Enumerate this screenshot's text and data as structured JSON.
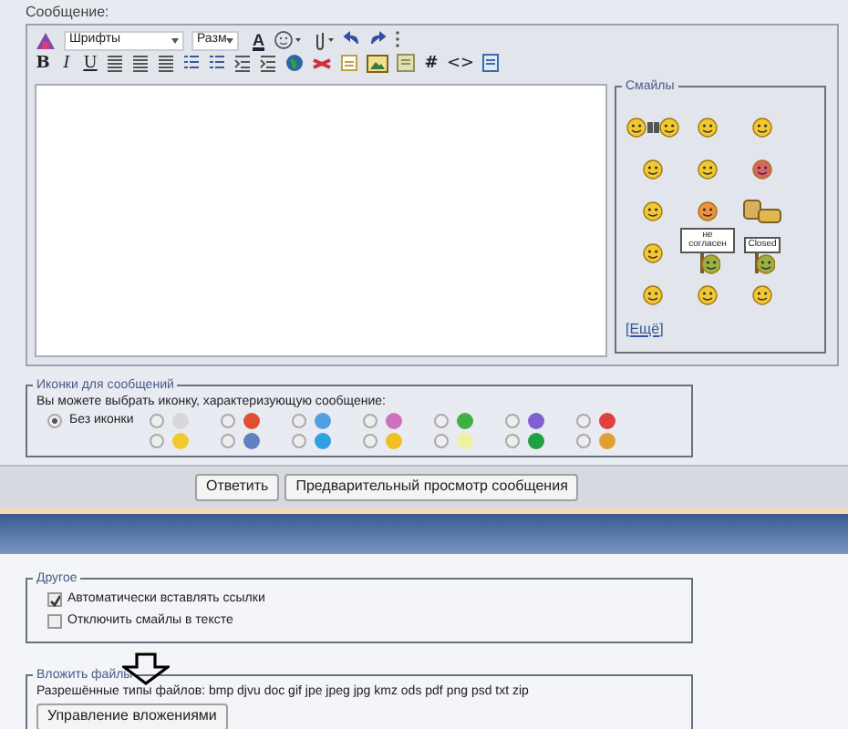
{
  "message_label": "Сообщение:",
  "toolbar": [
    [
      {
        "kind": "logo"
      },
      {
        "kind": "select",
        "value": "Шрифты"
      },
      {
        "kind": "select",
        "value": "Разм"
      },
      {
        "kind": "color",
        "text": "A"
      },
      {
        "kind": "smiley-menu"
      },
      {
        "kind": "attach-menu"
      },
      {
        "kind": "undo"
      },
      {
        "kind": "redo"
      },
      {
        "kind": "grip"
      }
    ],
    [
      {
        "kind": "bold",
        "text": "B"
      },
      {
        "kind": "italic",
        "text": "I"
      },
      {
        "kind": "underline",
        "text": "U"
      },
      {
        "kind": "align"
      },
      {
        "kind": "align"
      },
      {
        "kind": "align"
      },
      {
        "kind": "list"
      },
      {
        "kind": "list"
      },
      {
        "kind": "indent"
      },
      {
        "kind": "indent"
      },
      {
        "kind": "globe"
      },
      {
        "kind": "unlink"
      },
      {
        "kind": "doc"
      },
      {
        "kind": "image"
      },
      {
        "kind": "quote"
      },
      {
        "kind": "hash",
        "text": "#"
      },
      {
        "kind": "code",
        "text": "<>"
      },
      {
        "kind": "php"
      }
    ]
  ],
  "smilies": {
    "title": "Смайлы",
    "items": [
      {
        "kind": "beer"
      },
      {
        "kind": "face",
        "color": "#f2c830"
      },
      {
        "kind": "face",
        "color": "#f2c830"
      },
      {
        "kind": "face",
        "color": "#f2c830"
      },
      {
        "kind": "face",
        "color": "#f2c830"
      },
      {
        "kind": "face",
        "color": "#e0606a"
      },
      {
        "kind": "face",
        "color": "#f2c830"
      },
      {
        "kind": "face",
        "color": "#f09040"
      },
      {
        "kind": "bread"
      },
      {
        "kind": "face",
        "color": "#f2c830"
      },
      {
        "kind": "sign",
        "text": "не согласен"
      },
      {
        "kind": "sign",
        "text": "Closed"
      },
      {
        "kind": "face",
        "color": "#f2c830"
      },
      {
        "kind": "face",
        "color": "#f2c830"
      },
      {
        "kind": "face",
        "color": "#f2c830"
      }
    ],
    "more_link": "[Ещё]"
  },
  "post_icons": {
    "title": "Иконки для сообщений",
    "hint": "Вы можете выбрать иконку, характеризующую сообщение:",
    "none": {
      "label": "Без иконки",
      "selected": true
    },
    "icons": [
      {
        "color": "#d8d8d8",
        "selected": false
      },
      {
        "color": "#e05030",
        "selected": false
      },
      {
        "color": "#50a0e0",
        "selected": false
      },
      {
        "color": "#d070c0",
        "selected": false
      },
      {
        "color": "#40b040",
        "selected": false
      },
      {
        "color": "#8060d0",
        "selected": false
      },
      {
        "color": "#e04040",
        "selected": false
      },
      {
        "color": "#f2c830",
        "selected": false
      },
      {
        "color": "#6080c0",
        "selected": false
      },
      {
        "color": "#30a0e0",
        "selected": false
      },
      {
        "color": "#f0c020",
        "selected": false
      },
      {
        "color": "#f0f0a0",
        "selected": false
      },
      {
        "color": "#20a040",
        "selected": false
      },
      {
        "color": "#e0a030",
        "selected": false
      }
    ]
  },
  "buttons": [
    "Ответить",
    "Предварительный просмотр сообщения"
  ],
  "other": {
    "title": "Другое",
    "options": [
      {
        "label": "Автоматически вставлять ссылки",
        "checked": true
      },
      {
        "label": "Отключить смайлы в тексте",
        "checked": false
      }
    ]
  },
  "attach": {
    "title": "Вложить файлы",
    "allowed": "Разрешённые типы файлов: bmp djvu doc gif jpe jpeg jpg kmz ods pdf png psd txt zip",
    "button": "Управление вложениями"
  }
}
